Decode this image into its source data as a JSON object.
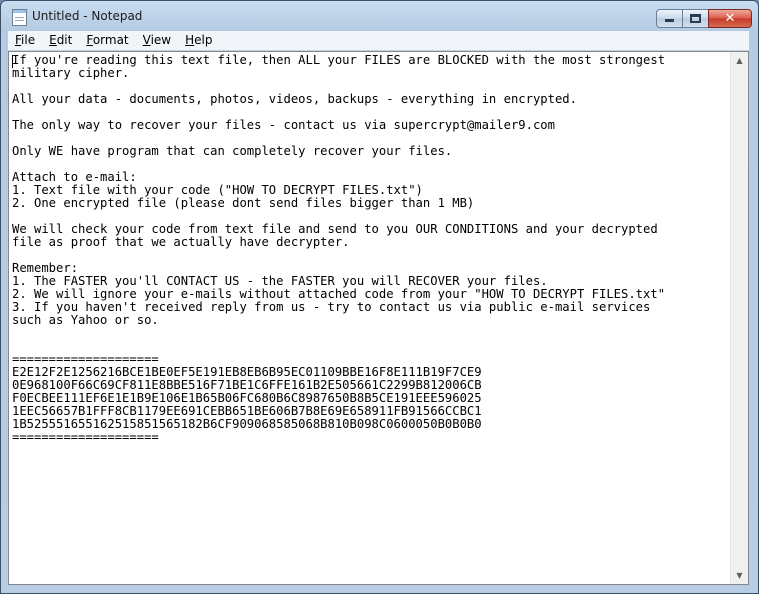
{
  "window": {
    "title": "Untitled - Notepad"
  },
  "menu": [
    {
      "accel": "F",
      "rest": "ile"
    },
    {
      "accel": "E",
      "rest": "dit"
    },
    {
      "accel": "F",
      "rest": "ormat"
    },
    {
      "accel": "V",
      "rest": "iew"
    },
    {
      "accel": "H",
      "rest": "elp"
    }
  ],
  "icons": {
    "app": "notepad-icon",
    "minimize": "minimize-icon",
    "maximize": "maximize-icon",
    "close": "close-icon",
    "scroll_up": "scroll-up-arrow-icon",
    "scroll_down": "scroll-down-arrow-icon"
  },
  "editor": {
    "content": "If you're reading this text file, then ALL your FILES are BLOCKED with the most strongest\nmilitary cipher.\n\nAll your data - documents, photos, videos, backups - everything in encrypted.\n\nThe only way to recover your files - contact us via supercrypt@mailer9.com\n\nOnly WE have program that can completely recover your files.\n\nAttach to e-mail:\n1. Text file with your code (\"HOW TO DECRYPT FILES.txt\")\n2. One encrypted file (please dont send files bigger than 1 MB)\n\nWe will check your code from text file and send to you OUR CONDITIONS and your decrypted\nfile as proof that we actually have decrypter.\n\nRemember:\n1. The FASTER you'll CONTACT US - the FASTER you will RECOVER your files.\n2. We will ignore your e-mails without attached code from your \"HOW TO DECRYPT FILES.txt\"\n3. If you haven't received reply from us - try to contact us via public e-mail services\nsuch as Yahoo or so.\n\n\n====================\nE2E12F2E1256216BCE1BE0EF5E191EB8EB6B95EC01109BBE16F8E111B19F7CE9\n0E968100F66C69CF811E8BBE516F71BE1C6FFE161B2E505661C2299B812006CB\nF0ECBEE111EF6E1E1B9E106E1B65B06FC680B6C8987650B8B5CE191EEE596025\n1EEC56657B1FFF8CB1179EE691CEBB651BE606B7B8E69E658911FB91566CCBC1\n1B525551655162515851565182B6CF909068585068B810B098C0600050B0B0B0\n===================="
  },
  "colors": {
    "title_bar": "#b4cbe3",
    "close_button": "#c53a28",
    "editor_bg": "#ffffff"
  }
}
